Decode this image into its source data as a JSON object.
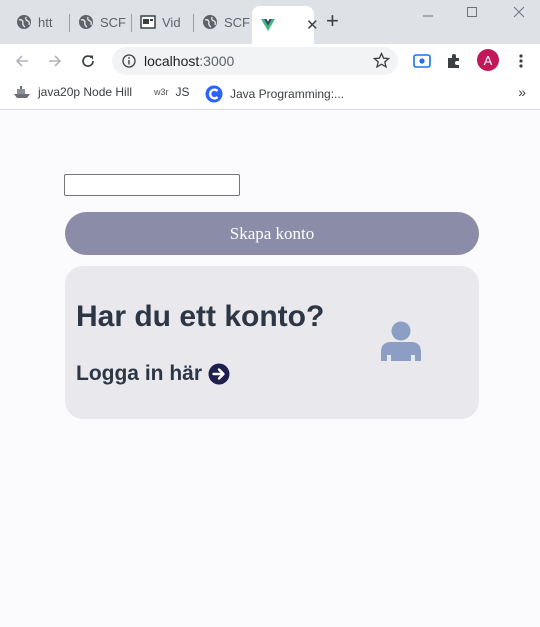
{
  "browser": {
    "tabs": [
      {
        "title": "htt",
        "icon": "globe-icon"
      },
      {
        "title": "SCF",
        "icon": "globe-icon"
      },
      {
        "title": "Vid",
        "icon": "video-icon"
      },
      {
        "title": "SCF",
        "icon": "globe-icon"
      },
      {
        "title": "",
        "icon": "vue-icon",
        "active": true
      }
    ],
    "new_tab": "+",
    "close_tab": "✕",
    "url_host": "localhost",
    "url_port": ":3000",
    "profile_initial": "A",
    "bookmarks": [
      {
        "label": "java20p Node Hill",
        "icon": "ship-icon"
      },
      {
        "label": "JS",
        "icon_text": "w3r"
      },
      {
        "label": "Java Programming:...",
        "icon": "c-logo-icon"
      }
    ],
    "bookmarks_more": "»",
    "colors": {
      "chrome_bg": "#dee1e6",
      "avatar": "#c2185b",
      "accent": "#1a73e8"
    }
  },
  "page": {
    "input_value": "",
    "create_button": "Skapa konto",
    "card_title": "Har du ett konto?",
    "login_link": "Logga in här",
    "colors": {
      "button": "#8b8ca8",
      "card": "#e9e9ed",
      "text": "#2c3645",
      "user_icon": "#8c9ec4"
    }
  }
}
